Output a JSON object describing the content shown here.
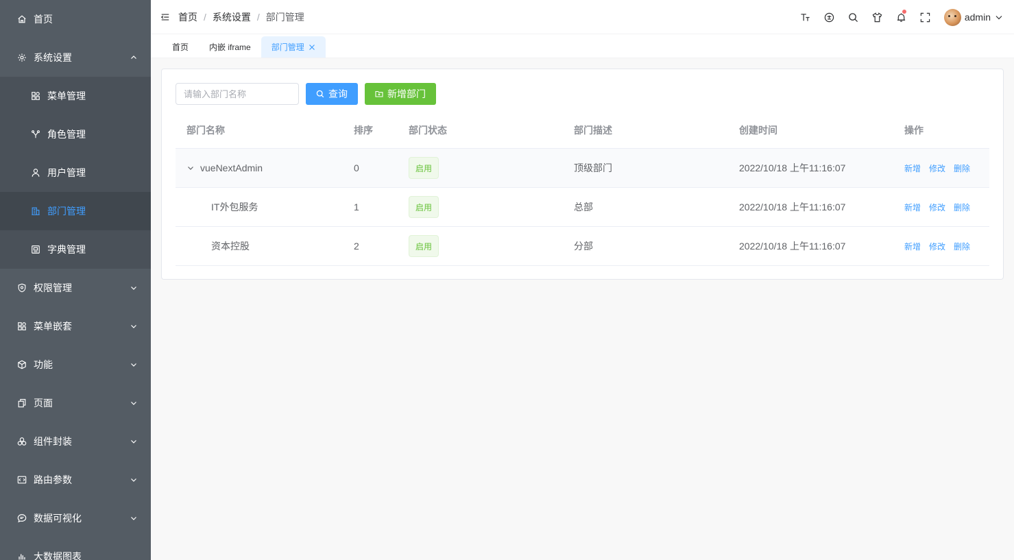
{
  "sidebar": {
    "items": [
      {
        "label": "首页",
        "icon": "home-icon",
        "type": "top"
      },
      {
        "label": "系统设置",
        "icon": "gear-icon",
        "type": "top",
        "expanded": true
      },
      {
        "label": "菜单管理",
        "icon": "grid-icon",
        "type": "sub"
      },
      {
        "label": "角色管理",
        "icon": "role-icon",
        "type": "sub"
      },
      {
        "label": "用户管理",
        "icon": "user-icon",
        "type": "sub"
      },
      {
        "label": "部门管理",
        "icon": "office-icon",
        "type": "sub",
        "active": true
      },
      {
        "label": "字典管理",
        "icon": "dict-icon",
        "type": "sub"
      },
      {
        "label": "权限管理",
        "icon": "shield-icon",
        "type": "top"
      },
      {
        "label": "菜单嵌套",
        "icon": "grid-icon",
        "type": "top"
      },
      {
        "label": "功能",
        "icon": "cube-icon",
        "type": "top"
      },
      {
        "label": "页面",
        "icon": "copy-icon",
        "type": "top"
      },
      {
        "label": "组件封装",
        "icon": "components-icon",
        "type": "top"
      },
      {
        "label": "路由参数",
        "icon": "route-icon",
        "type": "top"
      },
      {
        "label": "数据可视化",
        "icon": "chat-icon",
        "type": "top"
      },
      {
        "label": "大数据图表",
        "icon": "bar-chart-icon",
        "type": "top"
      }
    ]
  },
  "header": {
    "breadcrumb": [
      "首页",
      "系统设置",
      "部门管理"
    ],
    "separator": "/",
    "icons": [
      "font-size-icon",
      "language-icon",
      "search-icon",
      "skin-icon",
      "bell-icon",
      "fullscreen-icon"
    ],
    "username": "admin"
  },
  "tags": {
    "items": [
      "首页",
      "内嵌 iframe",
      "部门管理"
    ],
    "active_index": 2
  },
  "toolbar": {
    "search_placeholder": "请输入部门名称",
    "search_value": "",
    "query_label": "查询",
    "add_label": "新增部门"
  },
  "table": {
    "columns": [
      "部门名称",
      "排序",
      "部门状态",
      "部门描述",
      "创建时间",
      "操作"
    ],
    "rows": [
      {
        "name": "vueNextAdmin",
        "sort": "0",
        "status": "启用",
        "desc": "顶级部门",
        "time": "2022/10/18 上午11:16:07",
        "expandable": true
      },
      {
        "name": "IT外包服务",
        "sort": "1",
        "status": "启用",
        "desc": "总部",
        "time": "2022/10/18 上午11:16:07",
        "expandable": false
      },
      {
        "name": "资本控股",
        "sort": "2",
        "status": "启用",
        "desc": "分部",
        "time": "2022/10/18 上午11:16:07",
        "expandable": false
      }
    ],
    "actions": [
      "新增",
      "修改",
      "删除"
    ]
  },
  "colors": {
    "sidebar_bg": "#545c64",
    "active_text": "#409eff",
    "primary": "#409eff",
    "success": "#67c23a"
  }
}
